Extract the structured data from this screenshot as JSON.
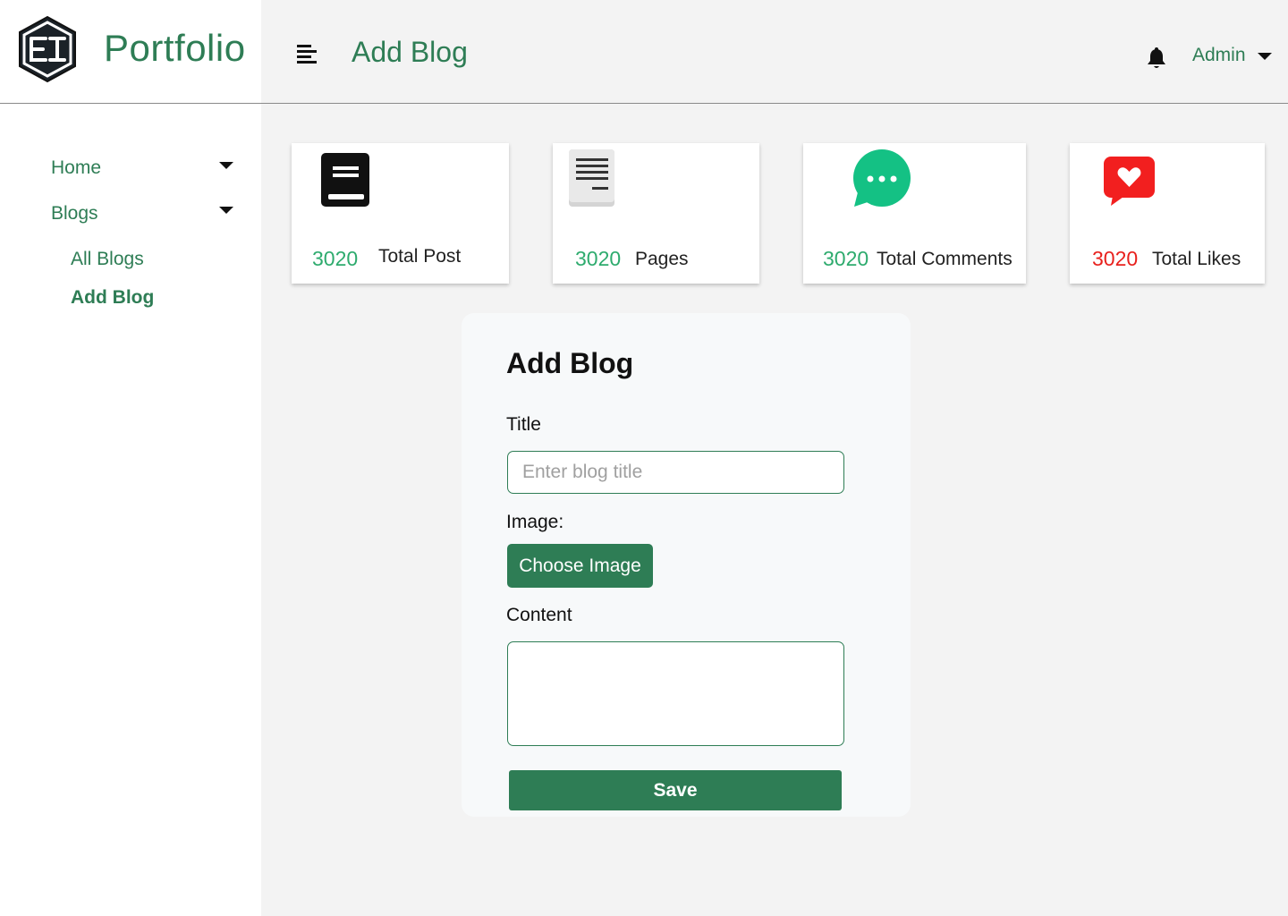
{
  "brand": {
    "name": "Portfolio",
    "logo_text": "EI"
  },
  "sidebar": {
    "items": [
      {
        "label": "Home",
        "icon": "caret-down-icon"
      },
      {
        "label": "Blogs",
        "icon": "caret-down-icon"
      }
    ],
    "sub_items": [
      {
        "label": "All Blogs",
        "active": false
      },
      {
        "label": "Add Blog",
        "active": true
      }
    ]
  },
  "header": {
    "menu_icon": "menu-icon",
    "title": "Add Blog",
    "notification_icon": "bell-icon",
    "user": "Admin"
  },
  "stats": [
    {
      "value": "3020",
      "label": "Total Post",
      "icon": "book-icon",
      "value_color": "#2eab6e"
    },
    {
      "value": "3020",
      "label": "Pages",
      "icon": "document-icon",
      "value_color": "#2eab6e"
    },
    {
      "value": "3020",
      "label": "Total Comments",
      "icon": "chat-bubble-icon",
      "value_color": "#2eab6e"
    },
    {
      "value": "3020",
      "label": "Total Likes",
      "icon": "heart-message-icon",
      "value_color": "#e8211d"
    }
  ],
  "form": {
    "heading": "Add Blog",
    "title_label": "Title",
    "title_placeholder": "Enter blog title",
    "title_value": "",
    "image_label": "Image:",
    "choose_image_label": "Choose Image",
    "content_label": "Content",
    "content_value": "",
    "save_label": "Save"
  },
  "colors": {
    "accent": "#2e7d55",
    "comment_icon": "#14c184",
    "like_icon": "#f21f1f",
    "background": "#f3f3f3"
  }
}
